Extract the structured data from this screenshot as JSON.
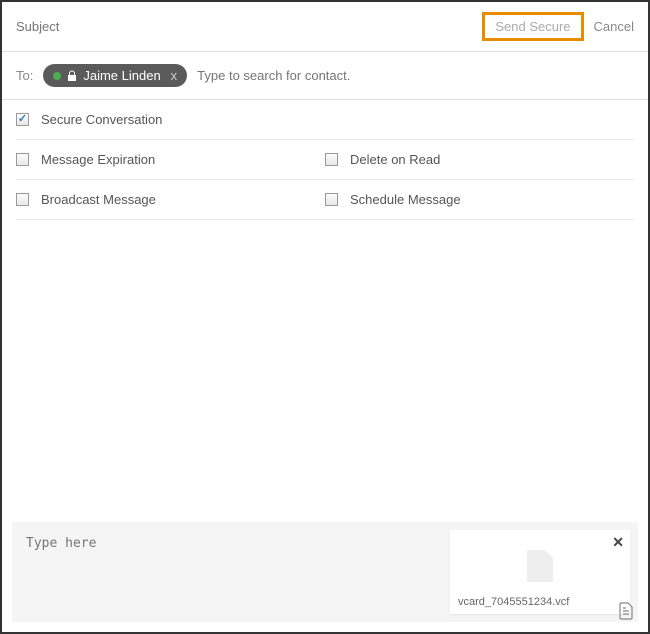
{
  "header": {
    "subject_placeholder": "Subject",
    "send_secure_label": "Send Secure",
    "cancel_label": "Cancel"
  },
  "to_row": {
    "label": "To:",
    "contact_name": "Jaime Linden",
    "remove_label": "x",
    "search_placeholder": "Type to search for contact."
  },
  "options": {
    "secure_conversation": "Secure Conversation",
    "message_expiration": "Message Expiration",
    "delete_on_read": "Delete on Read",
    "broadcast_message": "Broadcast Message",
    "schedule_message": "Schedule Message"
  },
  "compose": {
    "placeholder": "Type here"
  },
  "attachment": {
    "filename": "vcard_7045551234.vcf"
  }
}
